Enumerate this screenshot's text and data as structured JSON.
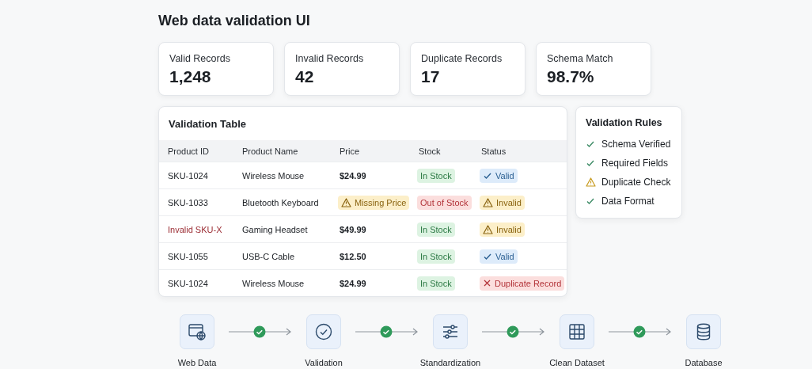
{
  "title": "Web data validation UI",
  "stats": [
    {
      "label": "Valid Records",
      "value": "1,248"
    },
    {
      "label": "Invalid Records",
      "value": "42"
    },
    {
      "label": "Duplicate Records",
      "value": "17"
    },
    {
      "label": "Schema Match",
      "value": "98.7%"
    }
  ],
  "table": {
    "title": "Validation Table",
    "columns": [
      "Product ID",
      "Product Name",
      "Price",
      "Stock",
      "Status"
    ],
    "rows": [
      {
        "id": "SKU-1024",
        "id_invalid": false,
        "name": "Wireless Mouse",
        "price": {
          "text": "$24.99",
          "kind": "plain"
        },
        "stock": {
          "label": "In Stock",
          "kind": "in"
        },
        "status": {
          "label": "Valid",
          "kind": "valid"
        }
      },
      {
        "id": "SKU-1033",
        "id_invalid": false,
        "name": "Bluetooth Keyboard",
        "price": {
          "text": "Missing Price",
          "kind": "warning"
        },
        "stock": {
          "label": "Out of Stock",
          "kind": "out"
        },
        "status": {
          "label": "Invalid",
          "kind": "invalid"
        }
      },
      {
        "id": "Invalid SKU-X",
        "id_invalid": true,
        "name": "Gaming Headset",
        "price": {
          "text": "$49.99",
          "kind": "plain"
        },
        "stock": {
          "label": "In Stock",
          "kind": "in"
        },
        "status": {
          "label": "Invalid",
          "kind": "invalid"
        }
      },
      {
        "id": "SKU-1055",
        "id_invalid": false,
        "name": "USB-C Cable",
        "price": {
          "text": "$12.50",
          "kind": "plain"
        },
        "stock": {
          "label": "In Stock",
          "kind": "in"
        },
        "status": {
          "label": "Valid",
          "kind": "valid"
        }
      },
      {
        "id": "SKU-1024",
        "id_invalid": false,
        "name": "Wireless Mouse",
        "price": {
          "text": "$24.99",
          "kind": "plain"
        },
        "stock": {
          "label": "In Stock",
          "kind": "in"
        },
        "status": {
          "label": "Duplicate Record",
          "kind": "duplicate"
        }
      }
    ]
  },
  "rules": {
    "title": "Validation Rules",
    "items": [
      {
        "label": "Schema Verified",
        "kind": "pass"
      },
      {
        "label": "Required Fields",
        "kind": "pass"
      },
      {
        "label": "Duplicate Check",
        "kind": "warning"
      },
      {
        "label": "Data Format",
        "kind": "pass"
      }
    ]
  },
  "pipeline": [
    {
      "label": "Web Data",
      "kind": "web"
    },
    {
      "label": "Validation",
      "kind": "check"
    },
    {
      "label": "Standardization",
      "kind": "sliders"
    },
    {
      "label": "Clean Dataset",
      "kind": "grid"
    },
    {
      "label": "Database",
      "kind": "database"
    }
  ]
}
